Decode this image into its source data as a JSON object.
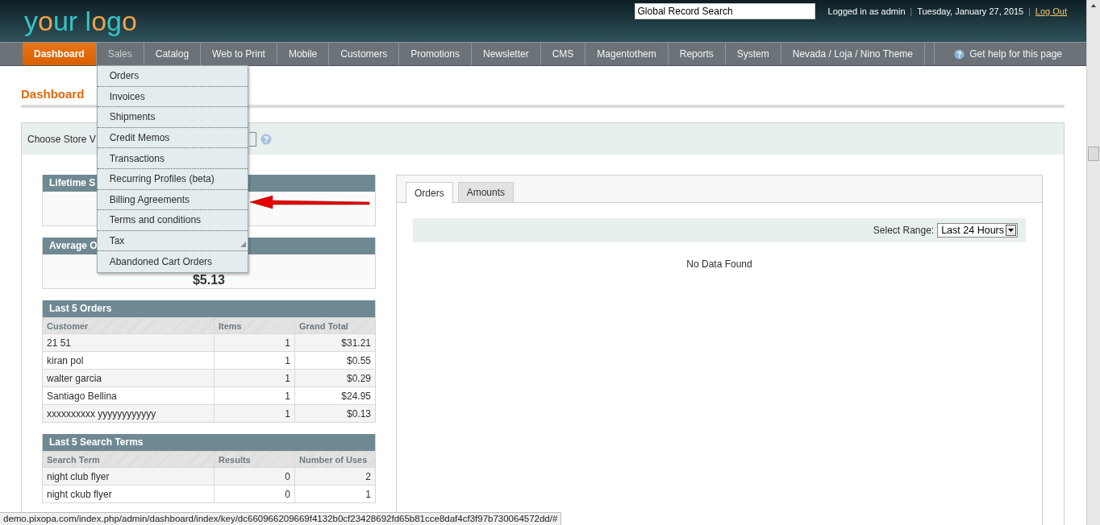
{
  "header": {
    "logo": [
      {
        "text": "y",
        "accent": false
      },
      {
        "text": "o",
        "accent": true
      },
      {
        "text": "ur l",
        "accent": false
      },
      {
        "text": "o",
        "accent": true
      },
      {
        "text": "g",
        "accent": false
      },
      {
        "text": "o",
        "accent": true
      }
    ],
    "search": {
      "value": "Global Record Search"
    },
    "user": "Logged in as admin",
    "separators": [
      "|",
      "|"
    ],
    "date": "Tuesday, January 27, 2015",
    "logout": "Log Out"
  },
  "nav": {
    "items": [
      {
        "label": "Dashboard",
        "selected": true,
        "expanded": false
      },
      {
        "label": "Sales",
        "selected": false,
        "expanded": true,
        "children": [
          {
            "label": "Orders",
            "has_submenu": false
          },
          {
            "label": "Invoices",
            "has_submenu": false
          },
          {
            "label": "Shipments",
            "has_submenu": false
          },
          {
            "label": "Credit Memos",
            "has_submenu": false
          },
          {
            "label": "Transactions",
            "has_submenu": false
          },
          {
            "label": "Recurring Profiles (beta)",
            "has_submenu": false
          },
          {
            "label": "Billing Agreements",
            "has_submenu": false
          },
          {
            "label": "Terms and conditions",
            "has_submenu": false
          },
          {
            "label": "Tax",
            "has_submenu": true
          },
          {
            "label": "Abandoned Cart Orders",
            "has_submenu": false
          }
        ]
      },
      {
        "label": "Catalog",
        "selected": false,
        "expanded": false
      },
      {
        "label": "Web to Print",
        "selected": false,
        "expanded": false
      },
      {
        "label": "Mobile",
        "selected": false,
        "expanded": false
      },
      {
        "label": "Customers",
        "selected": false,
        "expanded": false
      },
      {
        "label": "Promotions",
        "selected": false,
        "expanded": false
      },
      {
        "label": "Newsletter",
        "selected": false,
        "expanded": false
      },
      {
        "label": "CMS",
        "selected": false,
        "expanded": false
      },
      {
        "label": "Magentothem",
        "selected": false,
        "expanded": false
      },
      {
        "label": "Reports",
        "selected": false,
        "expanded": false
      },
      {
        "label": "System",
        "selected": false,
        "expanded": false
      },
      {
        "label": "Nevada / Loja / Nino Theme",
        "selected": false,
        "expanded": false
      }
    ],
    "help": "Get help for this page"
  },
  "page_title": "Dashboard",
  "store_chooser": {
    "label": "Choose Store V"
  },
  "lifetime_sales": {
    "title": "Lifetime S"
  },
  "average_orders": {
    "title": "Average O",
    "value": "$5.13"
  },
  "last_orders": {
    "title": "Last 5 Orders",
    "columns": [
      "Customer",
      "Items",
      "Grand Total"
    ],
    "rows": [
      [
        "21 51",
        "1",
        "$31.21"
      ],
      [
        "kiran pol",
        "1",
        "$0.55"
      ],
      [
        "walter garcia",
        "1",
        "$0.29"
      ],
      [
        "Santiago Bellina",
        "1",
        "$24.95"
      ],
      [
        "xxxxxxxxxx yyyyyyyyyyyy",
        "1",
        "$0.13"
      ]
    ]
  },
  "search_terms": {
    "title": "Last 5 Search Terms",
    "columns": [
      "Search Term",
      "Results",
      "Number of Uses"
    ],
    "rows": [
      [
        "night club flyer",
        "0",
        "2"
      ],
      [
        "night ckub flyer",
        "0",
        "1"
      ]
    ]
  },
  "chart_panel": {
    "tabs": [
      {
        "label": "Orders",
        "selected": true
      },
      {
        "label": "Amounts",
        "selected": false
      }
    ],
    "range_label": "Select Range:",
    "range_value": "Last 24 Hours",
    "empty": "No Data Found"
  },
  "status_bar": "demo.pixopa.com/index.php/admin/dashboard/index/key/dc660966209669f4132b0cf23428692fd65b81cce8daf4cf3f97b730064572dd/#"
}
